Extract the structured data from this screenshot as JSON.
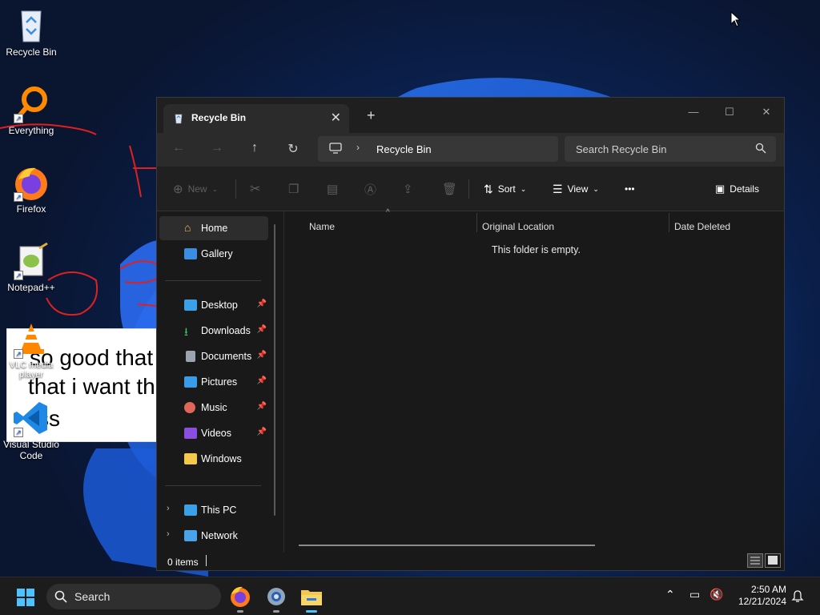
{
  "desktop": {
    "icons": [
      {
        "label": "Recycle Bin",
        "icon": "recycle-bin-icon"
      },
      {
        "label": "Everything",
        "icon": "everything-search-icon"
      },
      {
        "label": "Firefox",
        "icon": "firefox-icon"
      },
      {
        "label": "Notepad++",
        "icon": "notepadpp-icon"
      },
      {
        "label": "VLC media player",
        "icon": "vlc-icon"
      },
      {
        "label": "Visual Studio Code",
        "icon": "vscode-icon"
      }
    ],
    "meme_text": [
      "so good that",
      "that i want th",
      "ss"
    ]
  },
  "explorer": {
    "tab_title": "Recycle Bin",
    "tab_close": "✕",
    "new_tab": "+",
    "window_controls": {
      "minimize": "—",
      "maximize": "☐",
      "close": "✕"
    },
    "address": {
      "location": "Recycle Bin",
      "chevron": "›"
    },
    "search": {
      "placeholder": "Search Recycle Bin"
    },
    "command_bar": {
      "new_label": "New",
      "sort_label": "Sort",
      "view_label": "View",
      "more_label": "•••",
      "details_label": "Details"
    },
    "sidebar": {
      "home": "Home",
      "gallery": "Gallery",
      "desktop": "Desktop",
      "downloads": "Downloads",
      "documents": "Documents",
      "pictures": "Pictures",
      "music": "Music",
      "videos": "Videos",
      "windows": "Windows",
      "this_pc": "This PC",
      "network": "Network"
    },
    "columns": [
      "Name",
      "Original Location",
      "Date Deleted"
    ],
    "empty_message": "This folder is empty.",
    "status": {
      "item_count": "0 items"
    }
  },
  "taskbar": {
    "search_label": "Search",
    "apps": [
      "firefox-icon",
      "settings-icon",
      "file-explorer-icon"
    ],
    "clock": {
      "time": "2:50 AM",
      "date": "12/21/2024"
    }
  },
  "colors": {
    "window_bg": "#191919",
    "accent_blue": "#1f6fe0",
    "taskbar_bg": "#1c1c1c",
    "scribble_red": "#e02020"
  }
}
